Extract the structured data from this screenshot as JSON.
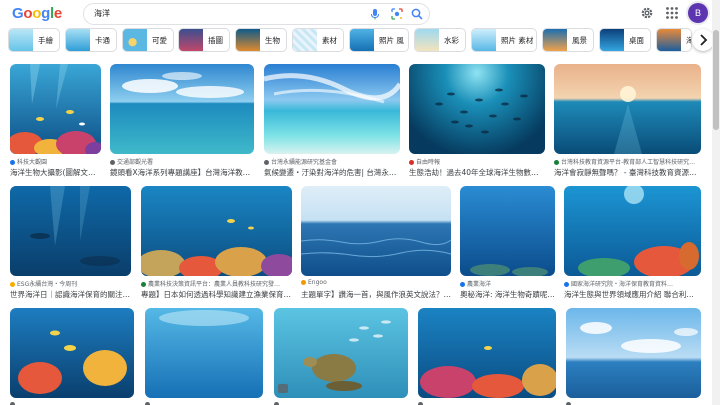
{
  "header": {
    "logo_letters": [
      "G",
      "o",
      "o",
      "g",
      "l",
      "e"
    ],
    "logo_colors": [
      "#4285F4",
      "#EA4335",
      "#FBBC05",
      "#4285F4",
      "#34A853",
      "#EA4335"
    ],
    "search_query": "海洋",
    "avatar_letter": "B",
    "avatar_color": "#5e35b1",
    "icons": [
      "mic-icon",
      "lens-icon",
      "search-icon",
      "gear-icon",
      "apps-icon"
    ]
  },
  "chips": [
    {
      "label": "手繪",
      "icon": "chip-thumb"
    },
    {
      "label": "卡通",
      "icon": "chip-thumb"
    },
    {
      "label": "可愛",
      "icon": "chip-thumb"
    },
    {
      "label": "插圖",
      "icon": "chip-thumb"
    },
    {
      "label": "生物",
      "icon": "chip-thumb"
    },
    {
      "label": "素材",
      "icon": "chip-thumb"
    },
    {
      "label": "照片 風",
      "icon": "chip-thumb"
    },
    {
      "label": "水彩",
      "icon": "chip-thumb"
    },
    {
      "label": "照片 素材",
      "icon": "chip-thumb"
    },
    {
      "label": "風景",
      "icon": "chip-thumb"
    },
    {
      "label": "桌面",
      "icon": "chip-thumb"
    },
    {
      "label": "海",
      "icon": "chip-thumb"
    }
  ],
  "results": [
    {
      "source": "科技大觀園",
      "title": "海洋生物大攝影(圖解文章…",
      "fav_color": "#1a73e8"
    },
    {
      "source": "交通部觀光署",
      "title": "鏡頭看X海洋系列專題講座】台灣海洋教育…",
      "fav_color": "#5f6368"
    },
    {
      "source": "台灣永續能源研究基金會",
      "title": "氣候變遷・汙染對海洋的危害| 台灣永續…",
      "fav_color": "#5f6368"
    },
    {
      "source": "自由時報",
      "title": "生態浩劫！過去40年全球海洋生物數量…",
      "fav_color": "#d93025"
    },
    {
      "source": "台灣科技教育資源平台-教育部人工智慧科技研究…",
      "title": "海洋會寂靜無聲嗎？ - 臺灣科技教育資源平台",
      "fav_color": "#188038"
    },
    {
      "source": "ESG永續台灣・今周刊",
      "title": "世界海洋日｜認識海洋保育的關注…",
      "fav_color": "#f9ab00"
    },
    {
      "source": "農業科技決策資訊平台：農業人員教科技研究發…",
      "title": "專題】日本如何透過科學知識建立漁業保育…",
      "fav_color": "#188038"
    },
    {
      "source": "Engoo",
      "title": "主題單字】讚海一首，與風作浪英文說法？…",
      "fav_color": "#f29900"
    },
    {
      "source": "農業海洋",
      "title": "奧秘海洋: 海洋生物奇蹟呢…",
      "fav_color": "#1a73e8"
    },
    {
      "source": "國家海洋研究院・海洋保育教育資料…",
      "title": "海洋生態與世界領域應用介紹 聯合利潤…",
      "fav_color": "#1a73e8"
    },
    {
      "source": "",
      "title": "",
      "fav_color": "#5f6368"
    },
    {
      "source": "",
      "title": "",
      "fav_color": "#5f6368"
    },
    {
      "source": "",
      "title": "",
      "fav_color": "#5f6368"
    },
    {
      "source": "",
      "title": "",
      "fav_color": "#5f6368"
    },
    {
      "source": "",
      "title": "",
      "fav_color": "#5f6368"
    }
  ],
  "colors": {
    "ocean_deep": "#0b4f8a",
    "ocean_mid": "#1a8fd0",
    "ocean_light": "#7fd3f0",
    "sky": "#bfe3f7",
    "coral": "#e5583c",
    "sand": "#e9dcc0"
  }
}
